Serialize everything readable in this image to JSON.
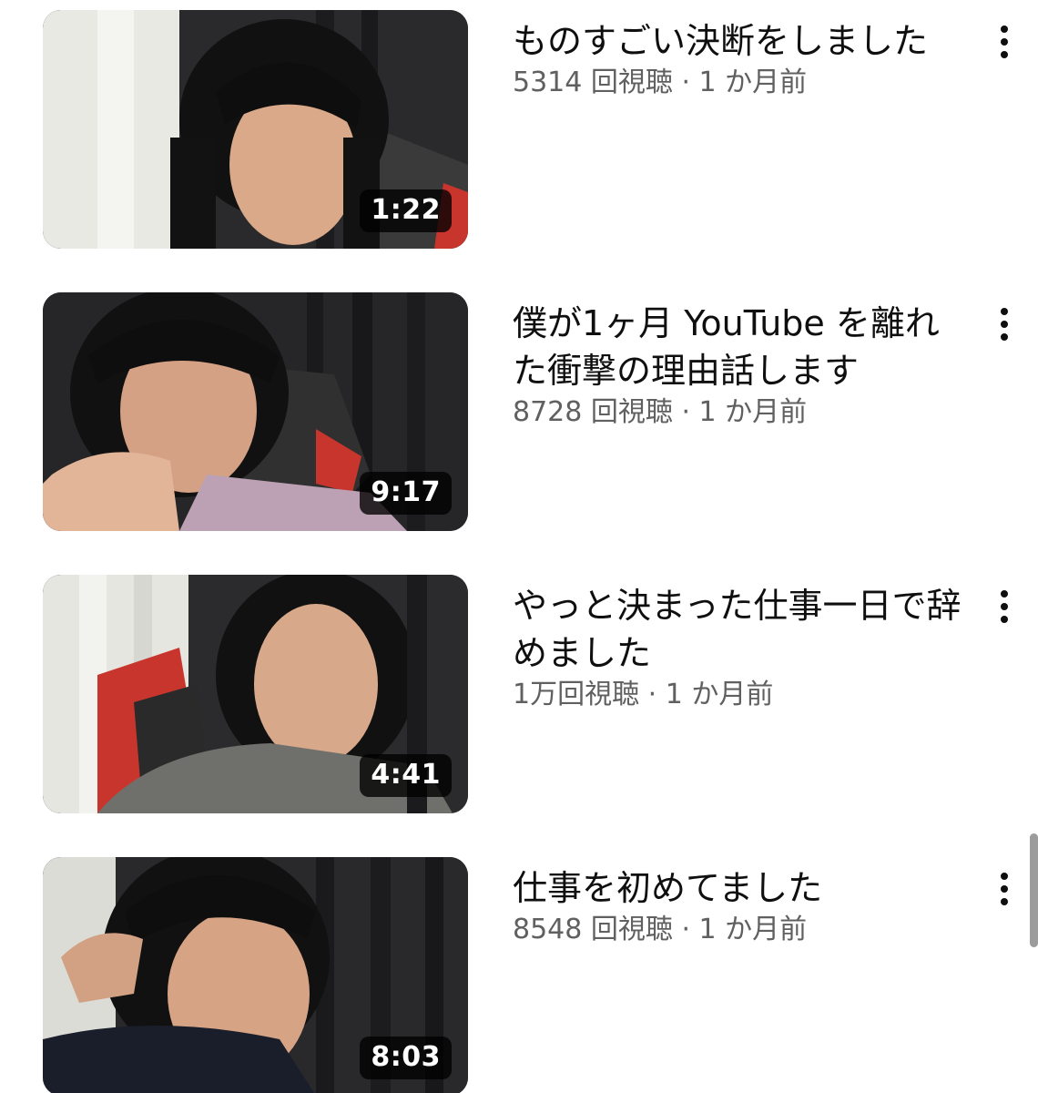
{
  "videos": [
    {
      "title": "ものすごい決断をしました",
      "views": "5314 回視聴",
      "age": "1 か月前",
      "duration": "1:22"
    },
    {
      "title": "僕が1ヶ月 YouTube を離れた衝撃の理由話します",
      "views": "8728 回視聴",
      "age": "1 か月前",
      "duration": "9:17"
    },
    {
      "title": "やっと決まった仕事一日で辞めました",
      "views": "1万回視聴",
      "age": "1 か月前",
      "duration": "4:41"
    },
    {
      "title": "仕事を初めてました",
      "views": "8548 回視聴",
      "age": "1 か月前",
      "duration": "8:03"
    }
  ],
  "separator": "·",
  "icons": {
    "more": "more-vert-icon"
  },
  "colors": {
    "title": "#0f0f0f",
    "meta": "#606060",
    "duration_bg": "#000000"
  }
}
